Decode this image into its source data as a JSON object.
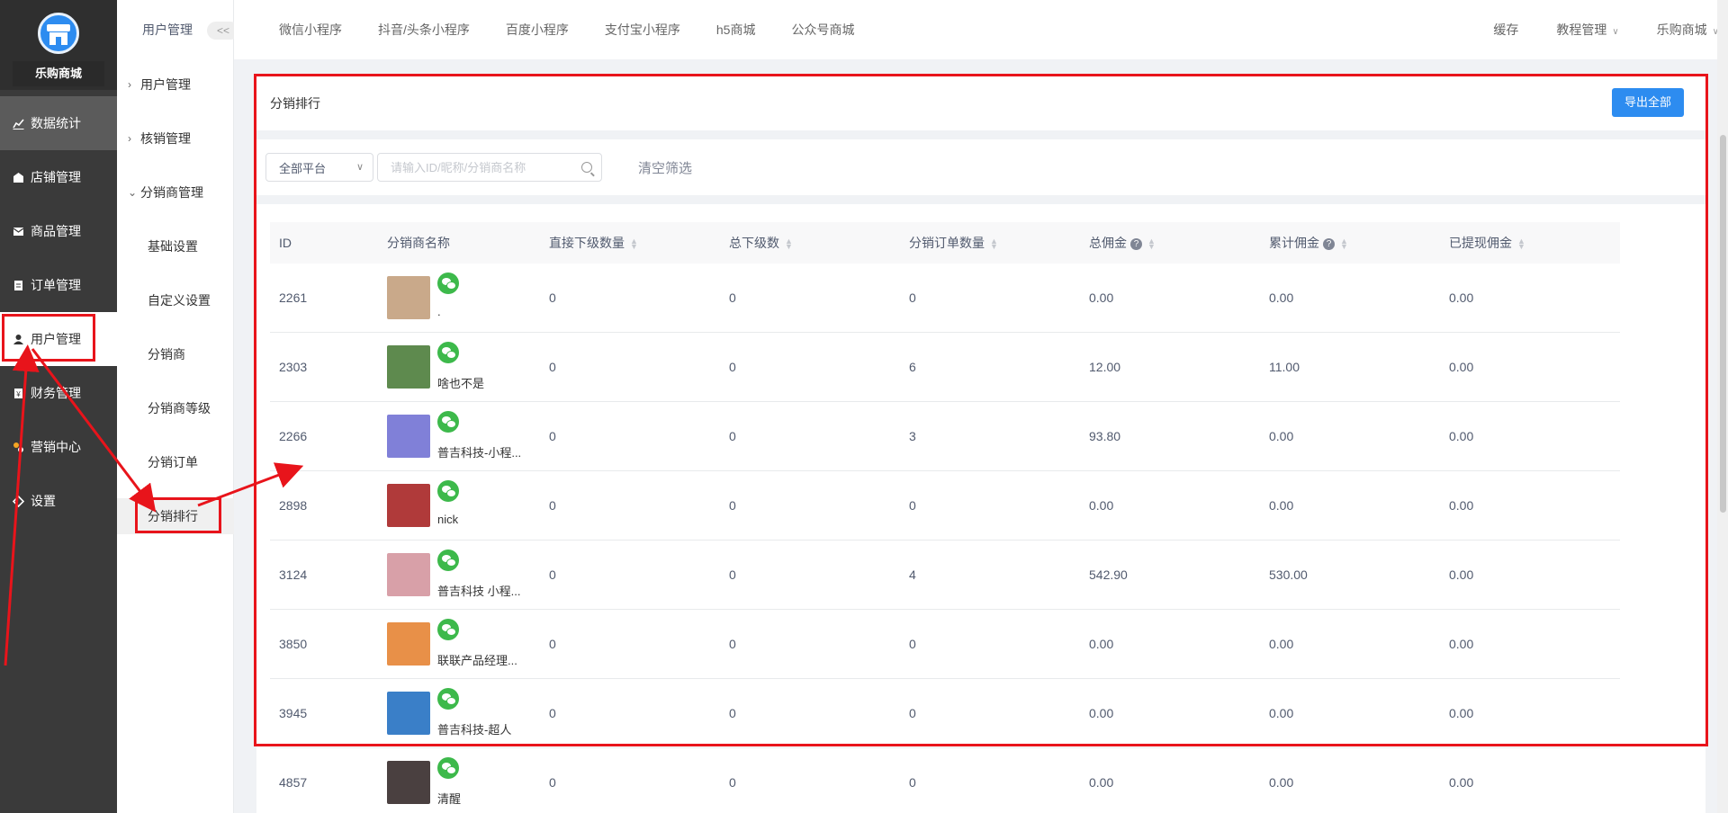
{
  "brand": {
    "name": "乐购商城"
  },
  "sidebar": {
    "items": [
      {
        "label": "数据统计",
        "icon": "chart-icon"
      },
      {
        "label": "店铺管理",
        "icon": "store-icon"
      },
      {
        "label": "商品管理",
        "icon": "goods-icon"
      },
      {
        "label": "订单管理",
        "icon": "order-icon"
      },
      {
        "label": "用户管理",
        "icon": "user-icon"
      },
      {
        "label": "财务管理",
        "icon": "finance-icon"
      },
      {
        "label": "营销中心",
        "icon": "marketing-icon"
      },
      {
        "label": "设置",
        "icon": "settings-icon"
      }
    ]
  },
  "submenu": {
    "title": "用户管理",
    "collapse": "<<",
    "items": [
      {
        "label": "用户管理"
      },
      {
        "label": "核销管理"
      },
      {
        "label": "分销商管理"
      },
      {
        "label": "基础设置"
      },
      {
        "label": "自定义设置"
      },
      {
        "label": "分销商"
      },
      {
        "label": "分销商等级"
      },
      {
        "label": "分销订单"
      },
      {
        "label": "分销排行"
      }
    ]
  },
  "topbar": {
    "tabs": [
      "微信小程序",
      "抖音/头条小程序",
      "百度小程序",
      "支付宝小程序",
      "h5商城",
      "公众号商城"
    ],
    "cache": "缓存",
    "tutorial": "教程管理",
    "shop": "乐购商城"
  },
  "panel": {
    "title": "分销排行",
    "export_label": "导出全部"
  },
  "filters": {
    "platform": "全部平台",
    "search_placeholder": "请输入ID/昵称/分销商名称",
    "clear_label": "清空筛选"
  },
  "table": {
    "headers": [
      "ID",
      "分销商名称",
      "直接下级数量",
      "总下级数",
      "分销订单数量",
      "总佣金",
      "累计佣金",
      "已提现佣金"
    ],
    "rows": [
      {
        "id": "2261",
        "name": ".",
        "direct": "0",
        "total": "0",
        "orders": "0",
        "commission": "0.00",
        "accumulated": "0.00",
        "withdrawn": "0.00",
        "avatar_color": "#c9a98a"
      },
      {
        "id": "2303",
        "name": "啥也不是",
        "direct": "0",
        "total": "0",
        "orders": "6",
        "commission": "12.00",
        "accumulated": "11.00",
        "withdrawn": "0.00",
        "avatar_color": "#5e8a4e"
      },
      {
        "id": "2266",
        "name": "普吉科技-小程...",
        "direct": "0",
        "total": "0",
        "orders": "3",
        "commission": "93.80",
        "accumulated": "0.00",
        "withdrawn": "0.00",
        "avatar_color": "#8080d8"
      },
      {
        "id": "2898",
        "name": "nick",
        "direct": "0",
        "total": "0",
        "orders": "0",
        "commission": "0.00",
        "accumulated": "0.00",
        "withdrawn": "0.00",
        "avatar_color": "#b03a3a"
      },
      {
        "id": "3124",
        "name": "普吉科技 小程...",
        "direct": "0",
        "total": "0",
        "orders": "4",
        "commission": "542.90",
        "accumulated": "530.00",
        "withdrawn": "0.00",
        "avatar_color": "#d8a0a8"
      },
      {
        "id": "3850",
        "name": "联联产品经理...",
        "direct": "0",
        "total": "0",
        "orders": "0",
        "commission": "0.00",
        "accumulated": "0.00",
        "withdrawn": "0.00",
        "avatar_color": "#e89048"
      },
      {
        "id": "3945",
        "name": "普吉科技-超人",
        "direct": "0",
        "total": "0",
        "orders": "0",
        "commission": "0.00",
        "accumulated": "0.00",
        "withdrawn": "0.00",
        "avatar_color": "#3a7fc8"
      },
      {
        "id": "4857",
        "name": "清醒",
        "direct": "0",
        "total": "0",
        "orders": "0",
        "commission": "0.00",
        "accumulated": "0.00",
        "withdrawn": "0.00",
        "avatar_color": "#4a4040"
      }
    ]
  },
  "annotation_color": "#e8141b"
}
